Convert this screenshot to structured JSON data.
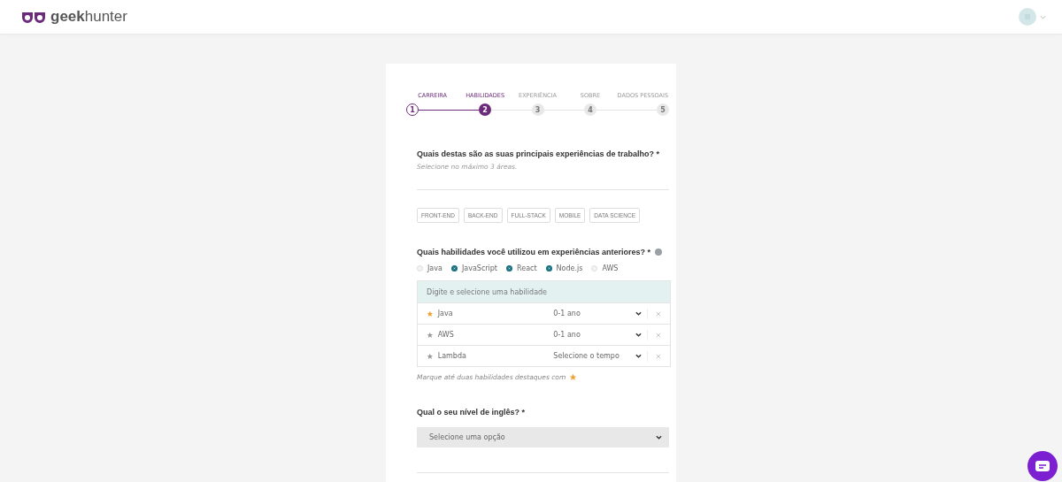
{
  "header": {
    "logo_text": "geek",
    "logo_text_light": "hunter"
  },
  "steps": [
    {
      "label": "CARREIRA",
      "number": "1",
      "completed": true,
      "selected": false
    },
    {
      "label": "HABILIDADES",
      "number": "2",
      "completed": false,
      "selected": true
    },
    {
      "label": "EXPERIÊNCIA",
      "number": "3",
      "completed": false,
      "selected": false
    },
    {
      "label": "SOBRE",
      "number": "4",
      "completed": false,
      "selected": false
    },
    {
      "label": "DADOS PESSOAIS",
      "number": "5",
      "completed": false,
      "selected": false
    }
  ],
  "areas": {
    "question": "Quais destas são as suas principais experiências de trabalho? *",
    "hint": "Selecione no máximo 3 áreas.",
    "options": [
      {
        "label": "FRONT-END",
        "selected": false
      },
      {
        "label": "BACK-END",
        "selected": false
      },
      {
        "label": "FULL-STACK",
        "selected": false
      },
      {
        "label": "MOBILE",
        "selected": false
      },
      {
        "label": "DATA SCIENCE",
        "selected": false
      }
    ]
  },
  "skills": {
    "question": "Quais habilidades você utilizou em experiências anteriores? *",
    "suggestions": [
      {
        "label": "Java",
        "selected": false
      },
      {
        "label": "JavaScript",
        "selected": true
      },
      {
        "label": "React",
        "selected": true
      },
      {
        "label": "Node.js",
        "selected": true
      },
      {
        "label": "AWS",
        "selected": false
      }
    ],
    "search": {
      "placeholder": "Digite e selecione uma habilidade"
    },
    "items": [
      {
        "name": "Java",
        "highlighted": true,
        "time": "0-1 ano"
      },
      {
        "name": "AWS",
        "highlighted": false,
        "time": "0-1 ano"
      },
      {
        "name": "Lambda",
        "highlighted": false,
        "time": "Selecione o tempo"
      }
    ],
    "footnote": "Marque até duas habilidades destaques com"
  },
  "english": {
    "question": "Qual o seu nível de inglês? *",
    "select": "Selecione uma opção"
  }
}
